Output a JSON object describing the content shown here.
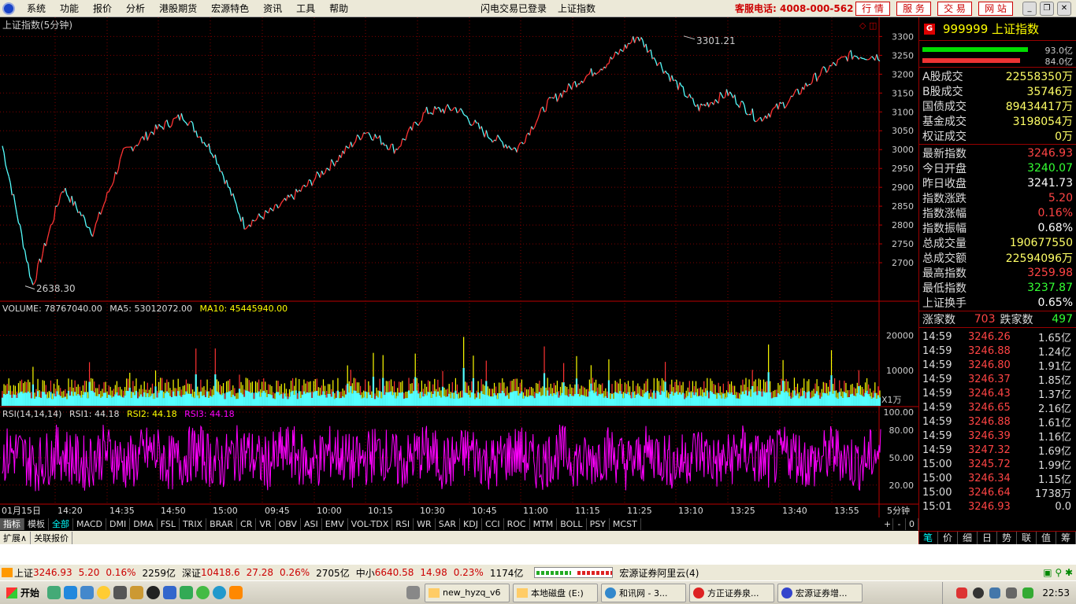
{
  "menu": {
    "items": [
      "系统",
      "功能",
      "报价",
      "分析",
      "港股期货",
      "宏源特色",
      "资讯",
      "工具",
      "帮助"
    ],
    "login_status": "闪电交易已登录",
    "current_view": "上证指数",
    "hotline": "客服电话: 4008-000-562",
    "top_buttons": [
      "行 情",
      "服 务",
      "交 易",
      "网 站"
    ]
  },
  "chart": {
    "title": "上证指数(5分钟)",
    "high_label": "3301.21",
    "low_label": "2638.30",
    "price_axis": [
      "3300",
      "3250",
      "3200",
      "3150",
      "3100",
      "3050",
      "3000",
      "2950",
      "2900",
      "2850",
      "2800",
      "2750",
      "2700"
    ],
    "volume_header": {
      "label": "VOLUME: 78767040.00",
      "ma5": "MA5: 53012072.00",
      "ma10": "MA10: 45445940.00"
    },
    "volume_axis": [
      "20000",
      "10000"
    ],
    "volume_unit": "X1万",
    "rsi_header": {
      "label": "RSI(14,14,14)",
      "rsi1": "RSI1: 44.18",
      "rsi2": "RSI2: 44.18",
      "rsi3": "RSI3: 44.18"
    },
    "rsi_axis": [
      "100.00",
      "80.00",
      "50.00",
      "20.00"
    ],
    "time_axis": [
      "01月15日",
      "14:20",
      "14:35",
      "14:50",
      "15:00",
      "09:45",
      "10:00",
      "10:15",
      "10:30",
      "10:45",
      "11:00",
      "11:15",
      "11:25",
      "13:10",
      "13:25",
      "13:40",
      "13:55"
    ],
    "period": "5分钟",
    "colors": {
      "up": "#ff3333",
      "down": "#55ffff",
      "ma5": "#ffff00",
      "rsi": "#ff00ff",
      "grid": "#800000"
    }
  },
  "chart_data": {
    "type": "line",
    "title": "上证指数(5分钟)",
    "ylim": [
      2600,
      3330
    ],
    "x": [
      "01月15日",
      "14:20",
      "14:35",
      "14:50",
      "15:00",
      "09:45",
      "10:00",
      "10:15",
      "10:30",
      "10:45",
      "11:00",
      "11:15",
      "11:25",
      "13:10",
      "13:25",
      "13:40",
      "13:55"
    ],
    "series": [
      {
        "name": "上证指数",
        "values": [
          3010,
          2638,
          2900,
          2780,
          2990,
          3050,
          3090,
          2990,
          2800,
          2840,
          2900,
          2970,
          3050,
          3000,
          3100,
          3110,
          3040,
          3000,
          3120,
          3180,
          3230,
          3301,
          3200,
          3110,
          3150,
          3080,
          3130,
          3200,
          3250,
          3246.93
        ]
      }
    ],
    "volume": {
      "ylim": [
        0,
        25000
      ],
      "unit": "X1万"
    },
    "rsi": {
      "ylim": [
        0,
        100
      ],
      "last": 44.18
    }
  },
  "quote": {
    "code": "999999 上证指数",
    "bar_up_label": "93.0亿",
    "bar_down_label": "84.0亿",
    "bar_up_ratio": 0.93,
    "bar_down_ratio": 0.84,
    "turnover": [
      {
        "label": "A股成交",
        "value": "22558350万"
      },
      {
        "label": "B股成交",
        "value": "35746万"
      },
      {
        "label": "国债成交",
        "value": "89434417万"
      },
      {
        "label": "基金成交",
        "value": "3198054万"
      },
      {
        "label": "权证成交",
        "value": "0万"
      }
    ],
    "stats": [
      {
        "label": "最新指数",
        "value": "3246.93",
        "color": "#ff4444"
      },
      {
        "label": "今日开盘",
        "value": "3240.07",
        "color": "#33ff33"
      },
      {
        "label": "昨日收盘",
        "value": "3241.73",
        "color": "#ffffff"
      },
      {
        "label": "指数涨跌",
        "value": "5.20",
        "color": "#ff4444"
      },
      {
        "label": "指数涨幅",
        "value": "0.16%",
        "color": "#ff4444"
      },
      {
        "label": "指数振幅",
        "value": "0.68%",
        "color": "#ffffff"
      },
      {
        "label": "总成交量",
        "value": "190677550",
        "color": "#ffff66"
      },
      {
        "label": "总成交额",
        "value": "22594096万",
        "color": "#ffff66"
      },
      {
        "label": "最高指数",
        "value": "3259.98",
        "color": "#ff4444"
      },
      {
        "label": "最低指数",
        "value": "3237.87",
        "color": "#33ff33"
      },
      {
        "label": "上证换手",
        "value": "0.65%",
        "color": "#ffffff"
      }
    ],
    "rise_label": "涨家数",
    "rise_count": "703",
    "fall_label": "跌家数",
    "fall_count": "497",
    "ticks": [
      {
        "time": "14:59",
        "price": "3246.26",
        "vol": "1.65亿"
      },
      {
        "time": "14:59",
        "price": "3246.88",
        "vol": "1.24亿"
      },
      {
        "time": "14:59",
        "price": "3246.80",
        "vol": "1.91亿"
      },
      {
        "time": "14:59",
        "price": "3246.37",
        "vol": "1.85亿"
      },
      {
        "time": "14:59",
        "price": "3246.43",
        "vol": "1.37亿"
      },
      {
        "time": "14:59",
        "price": "3246.65",
        "vol": "2.16亿"
      },
      {
        "time": "14:59",
        "price": "3246.88",
        "vol": "1.61亿"
      },
      {
        "time": "14:59",
        "price": "3246.39",
        "vol": "1.16亿"
      },
      {
        "time": "14:59",
        "price": "3247.32",
        "vol": "1.69亿"
      },
      {
        "time": "15:00",
        "price": "3245.72",
        "vol": "1.99亿"
      },
      {
        "time": "15:00",
        "price": "3246.34",
        "vol": "1.15亿"
      },
      {
        "time": "15:00",
        "price": "3246.64",
        "vol": "1738万"
      },
      {
        "time": "15:01",
        "price": "3246.93",
        "vol": "0.0"
      }
    ],
    "tabs": [
      "笔",
      "价",
      "细",
      "日",
      "势",
      "联",
      "值",
      "筹"
    ]
  },
  "indicators": [
    "指标",
    "模板",
    "全部",
    "MACD",
    "DMI",
    "DMA",
    "FSL",
    "TRIX",
    "BRAR",
    "CR",
    "VR",
    "OBV",
    "ASI",
    "EMV",
    "VOL-TDX",
    "RSI",
    "WR",
    "SAR",
    "KDJ",
    "CCI",
    "ROC",
    "MTM",
    "BOLL",
    "PSY",
    "MCST"
  ],
  "indicator_controls": [
    "+",
    "-",
    "0"
  ],
  "extend": [
    "扩展∧",
    "关联报价"
  ],
  "status": {
    "sh_label": "上证",
    "sh_value": "3246.93",
    "sh_change": "5.20",
    "sh_pct": "0.16%",
    "sh_amount": "2259亿",
    "sz_label": "深证",
    "sz_value": "10418.6",
    "sz_change": "27.28",
    "sz_pct": "0.26%",
    "sz_amount": "2705亿",
    "zx_label": "中小",
    "zx_value": "6640.58",
    "zx_change": "14.98",
    "zx_pct": "0.23%",
    "zx_amount": "1174亿",
    "server": "宏源证券阿里云(4)"
  },
  "taskbar": {
    "start": "开始",
    "tasks": [
      "new_hyzq_v6",
      "本地磁盘 (E:)",
      "和讯网 - 3...",
      "方正证券泉...",
      "宏源证券增..."
    ],
    "clock": "22:53"
  }
}
